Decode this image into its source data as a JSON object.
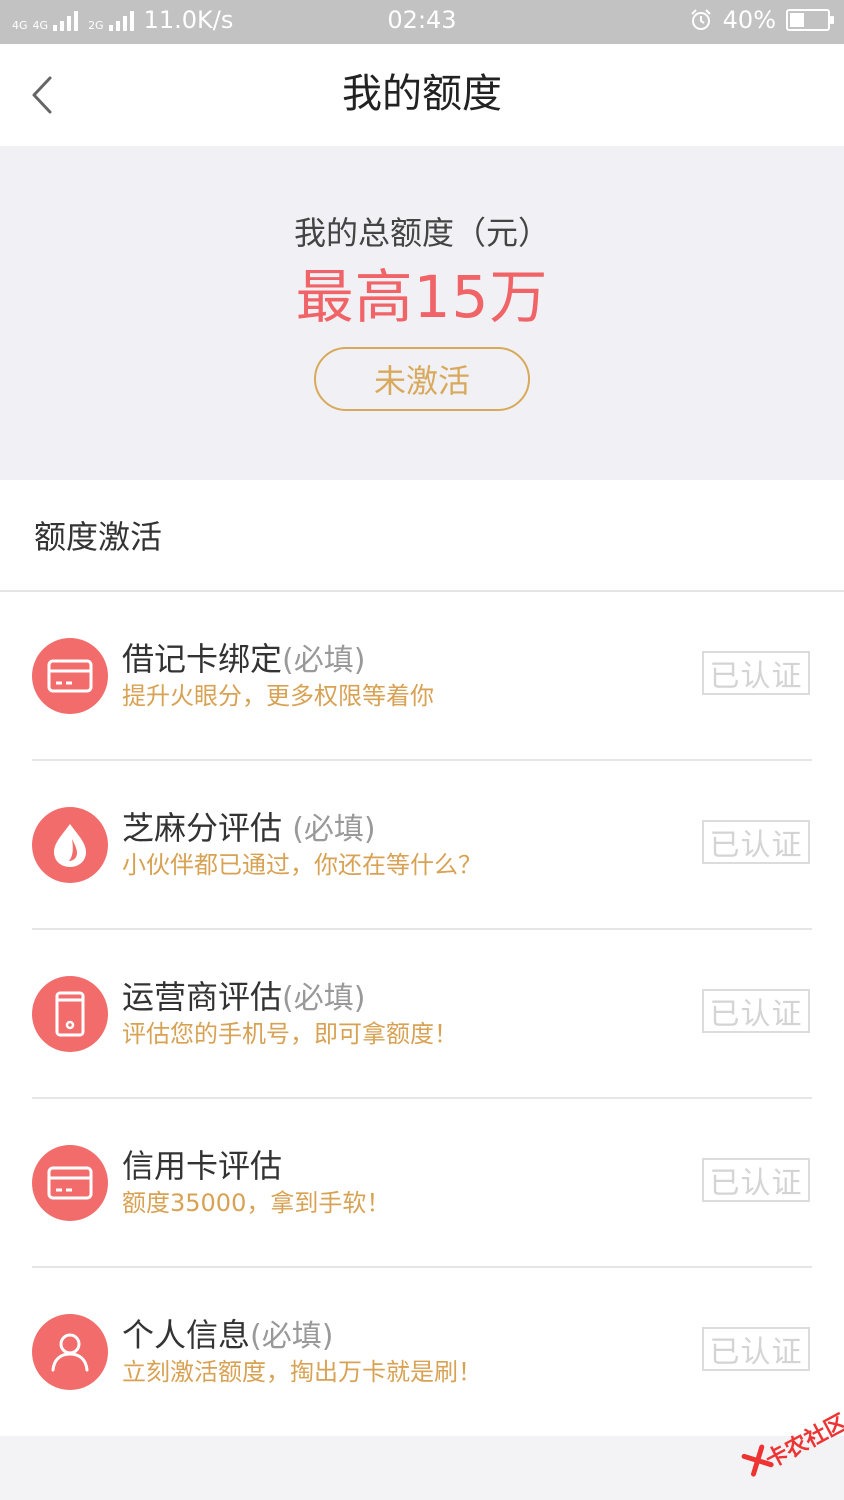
{
  "status_bar": {
    "network_1": "4G",
    "network_2": "4G",
    "network_3": "2G",
    "speed": "11.0K/s",
    "time": "02:43",
    "battery": "40%",
    "battery_level": 0.4
  },
  "header": {
    "title": "我的额度"
  },
  "summary": {
    "label": "我的总额度（元）",
    "amount": "最高15万",
    "activate_label": "未激活"
  },
  "section": {
    "title": "额度激活"
  },
  "items": [
    {
      "title": "借记卡绑定",
      "required": "(必填)",
      "subtitle": "提升火眼分，更多权限等着你",
      "status": "已认证",
      "icon": "card-icon"
    },
    {
      "title": "芝麻分评估 ",
      "required": "(必填)",
      "subtitle": "小伙伴都已通过，你还在等什么？",
      "status": "已认证",
      "icon": "sesame-icon"
    },
    {
      "title": "运营商评估",
      "required": "(必填)",
      "subtitle": "评估您的手机号，即可拿额度！",
      "status": "已认证",
      "icon": "phone-icon"
    },
    {
      "title": "信用卡评估",
      "required": "",
      "subtitle": "额度35000，拿到手软！",
      "status": "已认证",
      "icon": "card-icon"
    },
    {
      "title": "个人信息",
      "required": "(必填)",
      "subtitle": "立刻激活额度，掏出万卡就是刷！",
      "status": "已认证",
      "icon": "person-icon"
    }
  ],
  "watermark": {
    "text": "卡农社区"
  },
  "colors": {
    "accent_red": "#f06468",
    "gold": "#d8a95a",
    "icon_bg": "#f36c6c"
  }
}
